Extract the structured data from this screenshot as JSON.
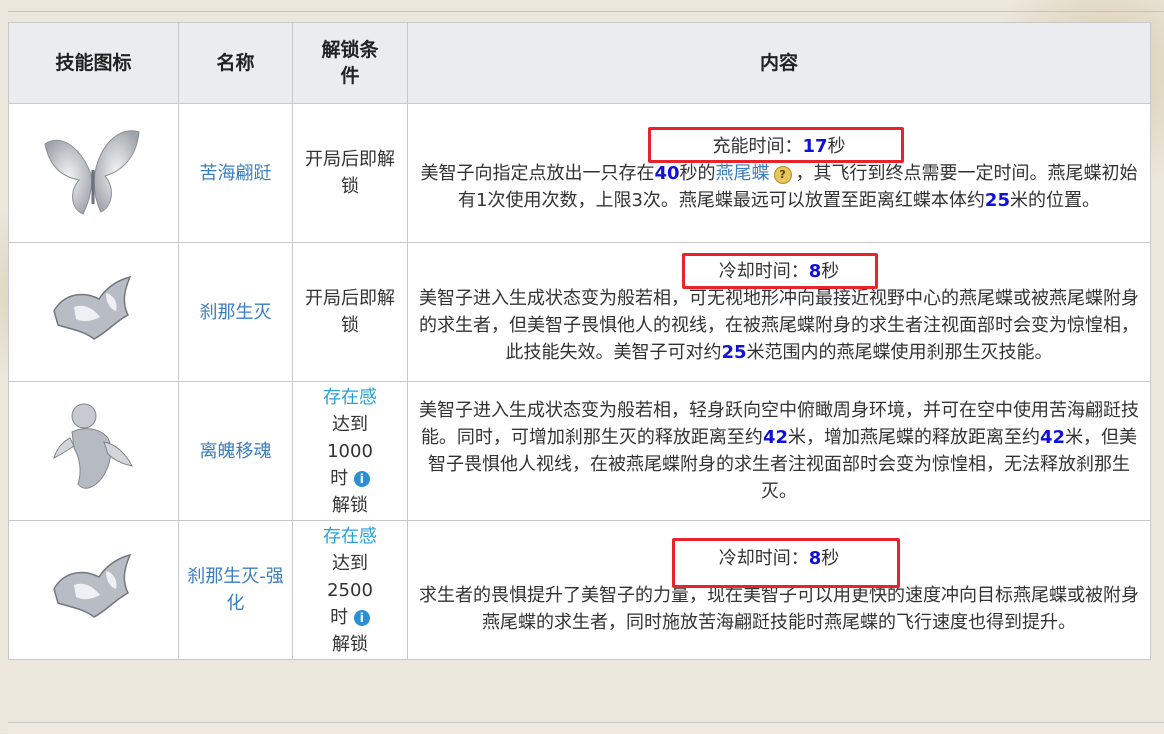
{
  "headers": {
    "icon": "技能图标",
    "name": "名称",
    "unlock": "解锁条件",
    "content": "内容"
  },
  "rows": [
    {
      "name": "苦海翩跹",
      "icon_name": "butterfly-wings-icon",
      "unlock_text": "开局后即解锁",
      "stat_label": "充能时间：",
      "stat_value": "17",
      "stat_unit": "秒",
      "desc_a": "美智子向指定点放出一只存在",
      "desc_num1": "40",
      "desc_b": "秒的",
      "desc_term": "燕尾蝶",
      "desc_c": "，其飞行到终点需要一定时间。燕尾蝶初始有1次使用次数，上限3次。燕尾蝶最远可以放置至距离红蝶本体约",
      "desc_num2": "25",
      "desc_d": "米的位置。"
    },
    {
      "name": "刹那生灭",
      "icon_name": "dash-slash-icon",
      "unlock_text": "开局后即解锁",
      "stat_label": "冷却时间：",
      "stat_value": "8",
      "stat_unit": "秒",
      "desc_a": "美智子进入生成状态变为般若相，可无视地形冲向最接近视野中心的燕尾蝶或被燕尾蝶附身的求生者，但美智子畏惧他人的视线，在被燕尾蝶附身的求生者注视面部时会变为惊惶相，此技能失效。美智子可对约",
      "desc_num1": "25",
      "desc_b": "米范围内的燕尾蝶使用刹那生灭技能。"
    },
    {
      "name": "离魄移魂",
      "icon_name": "floating-spirit-icon",
      "unlock_link": "存在感",
      "unlock_pre": "达到",
      "unlock_value": "1000",
      "unlock_post1": "时",
      "unlock_post2": "解锁",
      "desc_a": "美智子进入生成状态变为般若相，轻身跃向空中俯瞰周身环境，并可在空中使用苦海翩跹技能。同时，可增加刹那生灭的释放距离至约",
      "desc_num1": "42",
      "desc_b": "米，增加燕尾蝶的释放距离至约",
      "desc_num2": "42",
      "desc_c": "米，但美智子畏惧他人视线，在被燕尾蝶附身的求生者注视面部时会变为惊惶相，无法释放刹那生灭。"
    },
    {
      "name": "刹那生灭-强化",
      "icon_name": "dash-slash-enhanced-icon",
      "unlock_link": "存在感",
      "unlock_pre": "达到",
      "unlock_value": "2500",
      "unlock_post1": "时",
      "unlock_post2": "解锁",
      "stat_label": "冷却时间：",
      "stat_value": "8",
      "stat_unit": "秒",
      "desc_a": "求生者的畏惧提升了美智子的力量，现在美智子可以用更快的速度冲向目标燕尾蝶或被附身燕尾蝶的求生者，同时施放苦海翩跹技能时燕尾蝶的飞行速度也得到提升。"
    }
  ],
  "icons": {
    "info": "i",
    "help": "?"
  },
  "colors": {
    "link": "#3a7dc2",
    "number": "#1010dd",
    "highlight_box": "#e8232a",
    "unlock_link": "#29a2d6"
  }
}
